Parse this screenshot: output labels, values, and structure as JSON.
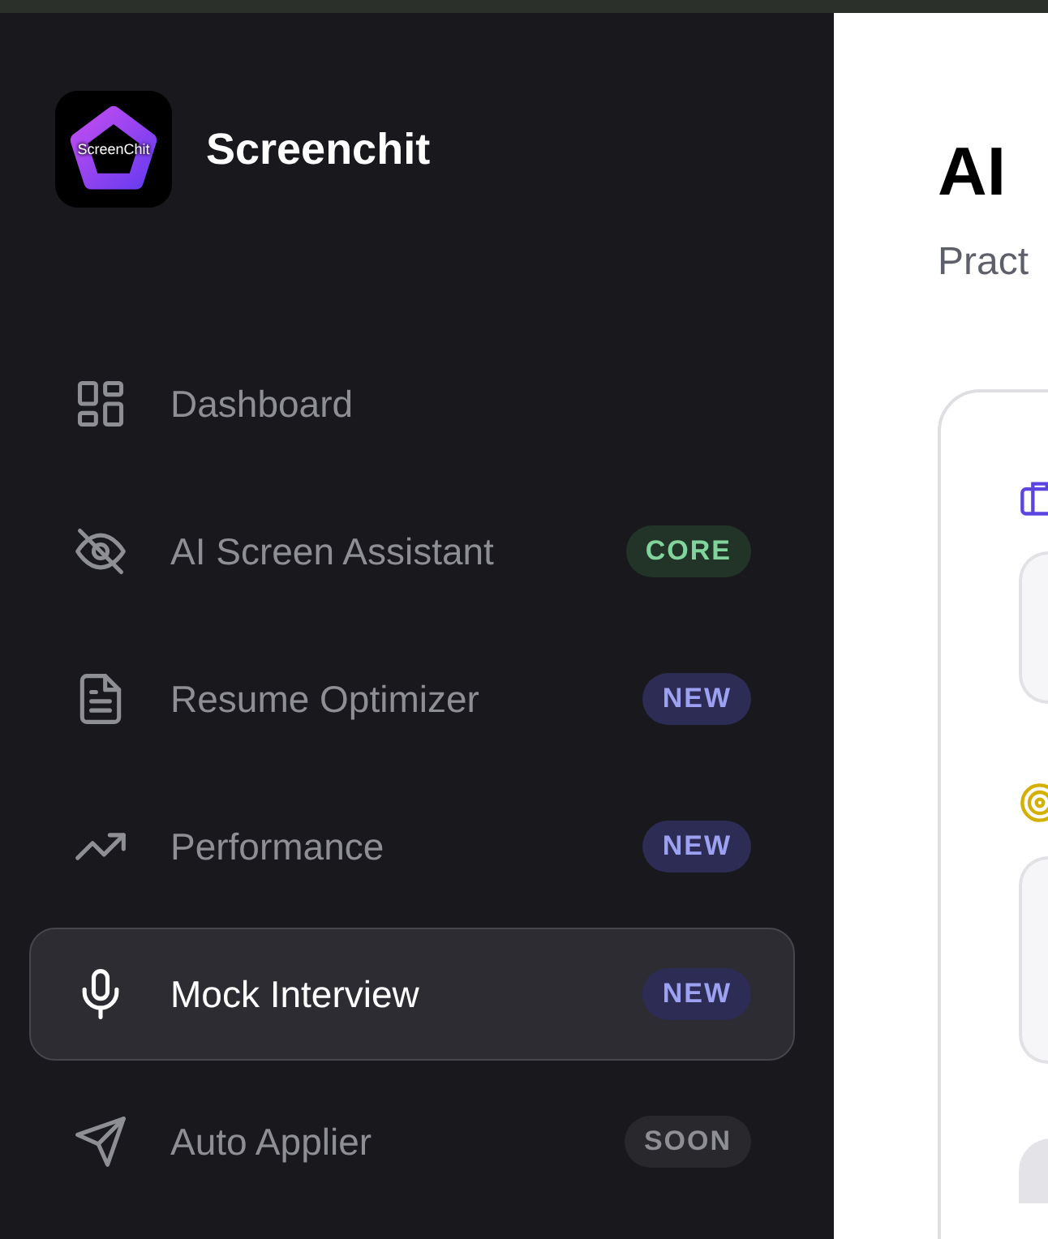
{
  "sidebar": {
    "logo": {
      "text": "ScreenChit"
    },
    "brand": "Screenchit",
    "items": [
      {
        "label": "Dashboard",
        "selected": false
      },
      {
        "label": "AI Screen Assistant",
        "selected": false,
        "badge": {
          "text": "CORE",
          "kind": "core"
        }
      },
      {
        "label": "Resume Optimizer",
        "selected": false,
        "badge": {
          "text": "NEW",
          "kind": "new"
        }
      },
      {
        "label": "Performance",
        "selected": false,
        "badge": {
          "text": "NEW",
          "kind": "new"
        }
      },
      {
        "label": "Mock Interview",
        "selected": true,
        "badge": {
          "text": "NEW",
          "kind": "new"
        }
      },
      {
        "label": "Auto Applier",
        "selected": false,
        "badge": {
          "text": "SOON",
          "kind": "soon"
        }
      }
    ]
  },
  "main": {
    "title": "AI",
    "subtitle": "Pract"
  }
}
